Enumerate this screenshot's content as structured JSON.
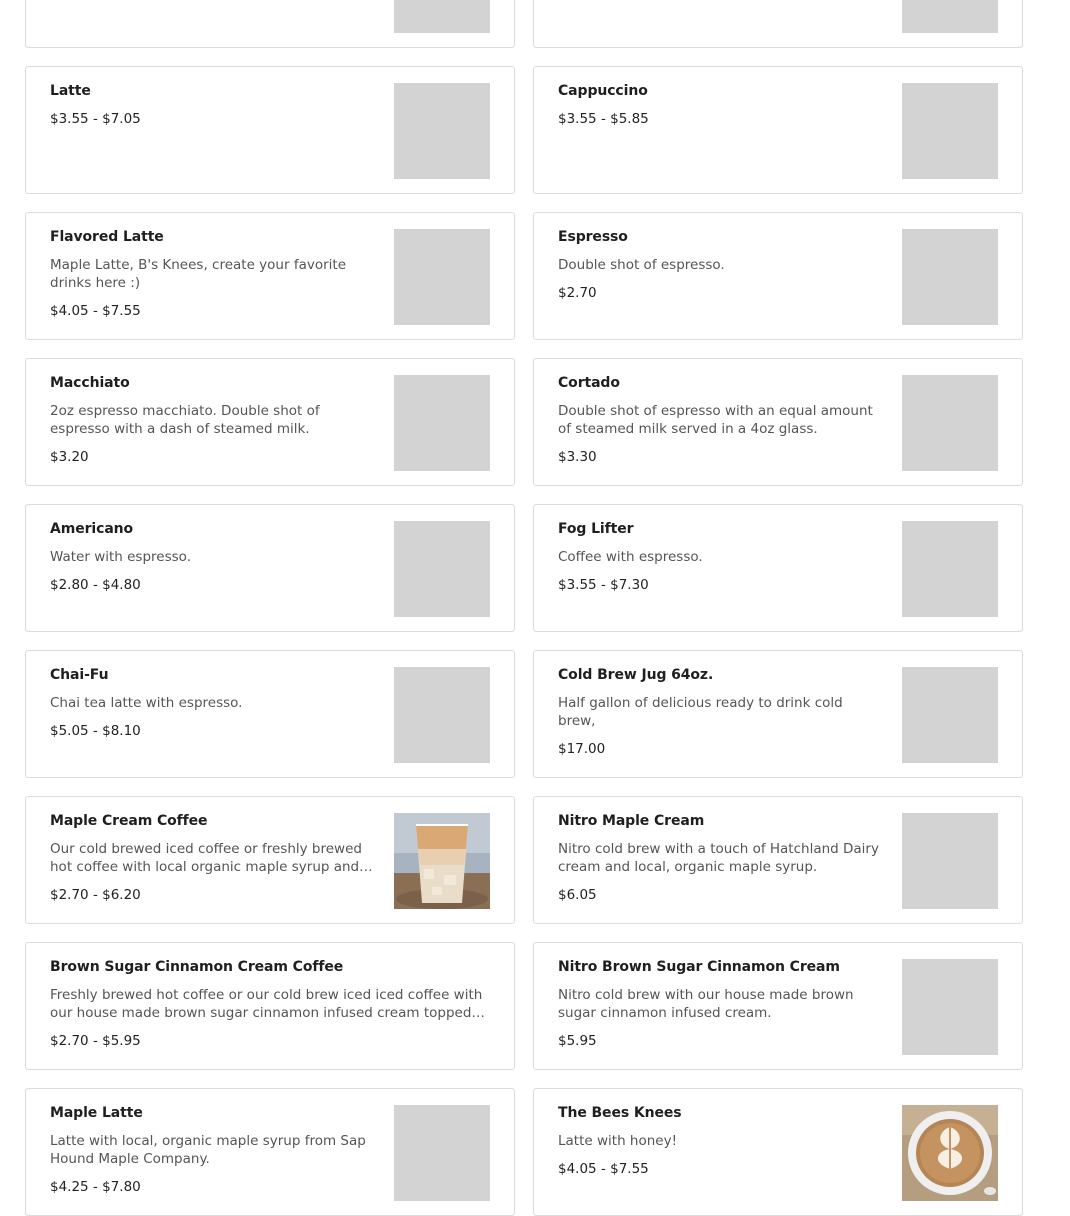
{
  "items": [
    {
      "name": "",
      "desc": "",
      "price": ""
    },
    {
      "name": "",
      "desc": "",
      "price": ""
    },
    {
      "name": "Latte",
      "desc": "",
      "price": "$3.55 - $7.05"
    },
    {
      "name": "Cappuccino",
      "desc": "",
      "price": "$3.55 - $5.85"
    },
    {
      "name": "Flavored Latte",
      "desc": "Maple Latte, B's Knees, create your favorite drinks here :)",
      "price": "$4.05 - $7.55"
    },
    {
      "name": "Espresso",
      "desc": "Double shot of espresso.",
      "price": "$2.70"
    },
    {
      "name": "Macchiato",
      "desc": "2oz espresso macchiato. Double shot of espresso with a dash of steamed milk.",
      "price": "$3.20"
    },
    {
      "name": "Cortado",
      "desc": "Double shot of espresso with an equal amount of steamed milk served in a 4oz glass.",
      "price": "$3.30"
    },
    {
      "name": "Americano",
      "desc": "Water with espresso.",
      "price": "$2.80 - $4.80"
    },
    {
      "name": "Fog Lifter",
      "desc": "Coffee with espresso.",
      "price": "$3.55 - $7.30"
    },
    {
      "name": "Chai-Fu",
      "desc": "Chai tea latte with espresso.",
      "price": "$5.05 - $8.10"
    },
    {
      "name": "Cold Brew Jug 64oz.",
      "desc": "Half gallon of delicious ready to drink cold brew,",
      "price": "$17.00"
    },
    {
      "name": "Maple Cream Coffee",
      "desc": "Our cold brewed iced coffee or freshly brewed hot coffee with local organic maple syrup and…",
      "price": "$2.70 - $6.20"
    },
    {
      "name": "Nitro Maple Cream",
      "desc": "Nitro cold brew with a touch of Hatchland Dairy cream and local, organic maple syrup.",
      "price": "$6.05"
    },
    {
      "name": "Brown Sugar Cinnamon Cream Coffee",
      "desc": "Freshly brewed hot coffee or our cold brew iced iced coffee with our house made brown sugar cinnamon infused cream topped with ou…",
      "price": "$2.70 - $5.95"
    },
    {
      "name": "Nitro Brown Sugar Cinnamon Cream",
      "desc": "Nitro cold brew with our house made brown sugar cinnamon infused cream.",
      "price": "$5.95"
    },
    {
      "name": "Maple Latte",
      "desc": "Latte with local, organic maple syrup from Sap Hound Maple Company.",
      "price": "$4.25 - $7.80"
    },
    {
      "name": "The Bees Knees",
      "desc": "Latte with honey!",
      "price": "$4.05 - $7.55"
    }
  ],
  "colors": {
    "placeholder": "#d3d3d3",
    "border": "#dcdcdc"
  }
}
